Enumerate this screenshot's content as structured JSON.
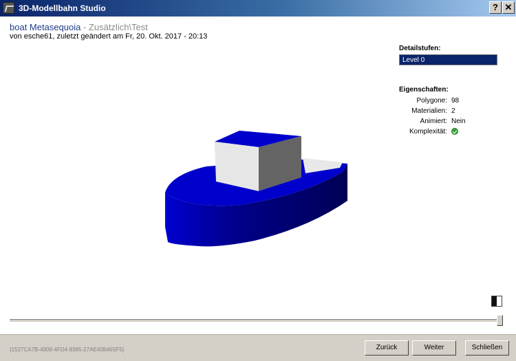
{
  "window": {
    "title": "3D-Modellbahn Studio",
    "help_label": "?",
    "close_label": "✕"
  },
  "model": {
    "name": "boat Metasequoia",
    "path": " - Zusätzlich\\Test",
    "subtitle": "von esche61, zuletzt geändert am Fr, 20. Okt. 2017 - 20:13"
  },
  "lod": {
    "heading": "Detailstufen:",
    "items": [
      "Level 0"
    ]
  },
  "properties": {
    "heading": "Eigenschaften:",
    "polygons_label": "Polygone:",
    "polygons_value": "98",
    "materials_label": "Materialien:",
    "materials_value": "2",
    "animated_label": "Animiert:",
    "animated_value": "Nein",
    "complexity_label": "Komplexität:",
    "complexity_icon": "check-circle-icon"
  },
  "footer": {
    "guid": "{1527CA7B-4909-4FD4-8385-27AE40846SF5}",
    "back_label": "Zurück",
    "next_label": "Weiter",
    "close_label": "Schließen"
  },
  "colors": {
    "hull": "#0000cc",
    "cabin": "#e6e6e6",
    "selection": "#0a246a"
  }
}
